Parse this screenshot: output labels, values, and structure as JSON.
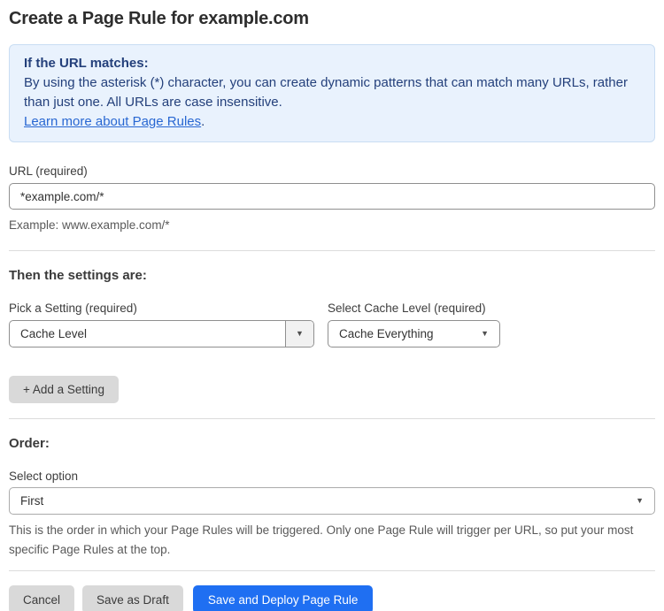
{
  "page": {
    "title": "Create a Page Rule for example.com"
  },
  "info_box": {
    "heading": "If the URL matches:",
    "body": "By using the asterisk (*) character, you can create dynamic patterns that can match many URLs, rather than just one. All URLs are case insensitive.",
    "link_label": "Learn more about Page Rules",
    "link_suffix": "."
  },
  "url_field": {
    "label": "URL (required)",
    "value": "*example.com/*",
    "helper": "Example: www.example.com/*"
  },
  "settings_section": {
    "heading": "Then the settings are:",
    "setting_picker": {
      "label": "Pick a Setting (required)",
      "value": "Cache Level"
    },
    "cache_level_picker": {
      "label": "Select Cache Level (required)",
      "value": "Cache Everything"
    },
    "add_setting_label": "+ Add a Setting"
  },
  "order_section": {
    "heading": "Order:",
    "select_label": "Select option",
    "value": "First",
    "helper": "This is the order in which your Page Rules will be triggered. Only one Page Rule will trigger per URL, so put your most specific Page Rules at the top."
  },
  "footer": {
    "cancel_label": "Cancel",
    "save_draft_label": "Save as Draft",
    "save_deploy_label": "Save and Deploy Page Rule"
  },
  "colors": {
    "info_box_bg": "#e9f2fd",
    "info_box_border": "#c9ddf3",
    "info_text": "#24407b",
    "link": "#2867d2",
    "primary_button_bg": "#1f6ff2",
    "gray_button_bg": "#d9d9d9"
  },
  "icons": {
    "caret_down": "▼"
  }
}
